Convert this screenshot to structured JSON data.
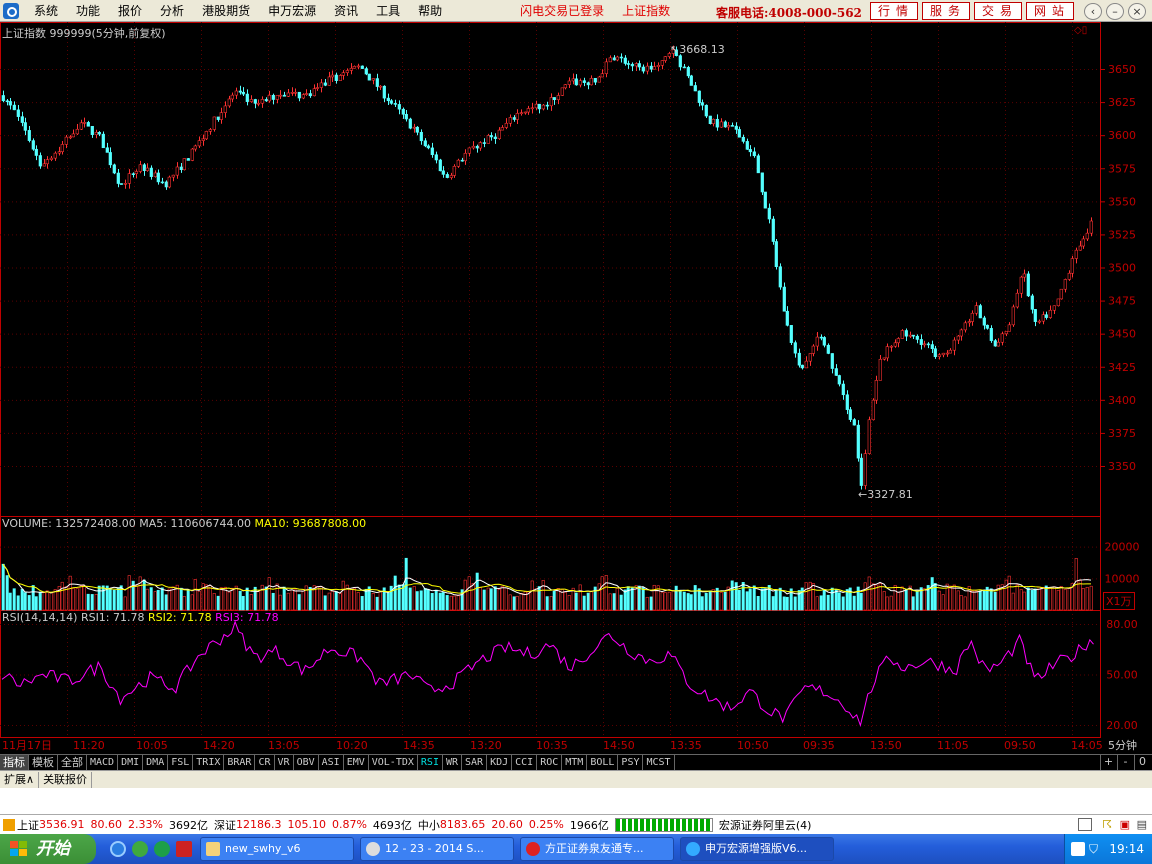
{
  "menubar": {
    "items": [
      "系统",
      "功能",
      "报价",
      "分析",
      "港股期货",
      "申万宏源",
      "资讯",
      "工具",
      "帮助"
    ],
    "status": "闪电交易已登录",
    "index_link": "上证指数",
    "hotline": "客服电话:4008-000-562",
    "buttons": [
      "行情",
      "服务",
      "交易",
      "网站"
    ]
  },
  "main_chart": {
    "header": "上证指数 999999(5分钟,前复权)",
    "y_ticks": [
      "3650",
      "3625",
      "3600",
      "3575",
      "3550",
      "3525",
      "3500",
      "3475",
      "3450",
      "3425",
      "3400",
      "3375",
      "3350"
    ],
    "high_label": "3668.13",
    "low_label": "3327.81"
  },
  "volume": {
    "header_volume": "VOLUME: 132572408.00",
    "header_ma5": "MA5: 110606744.00",
    "header_ma10": "MA10: 93687808.00",
    "y_ticks": [
      "20000",
      "10000"
    ],
    "unit": "X1万"
  },
  "rsi": {
    "header_name": "RSI(14,14,14)",
    "rsi1": "RSI1: 71.78",
    "rsi2": "RSI2: 71.78",
    "rsi3": "RSI3: 71.78",
    "y_ticks": [
      "80.00",
      "50.00",
      "20.00"
    ]
  },
  "time_axis": {
    "labels": [
      "11月17日",
      "11:20",
      "10:05",
      "14:20",
      "13:05",
      "10:20",
      "14:35",
      "13:20",
      "10:35",
      "14:50",
      "13:35",
      "10:50",
      "09:35",
      "13:50",
      "11:05",
      "09:50",
      "14:05"
    ],
    "period": "5分钟"
  },
  "tabs": {
    "items": [
      "指标",
      "模板",
      "全部",
      "MACD",
      "DMI",
      "DMA",
      "FSL",
      "TRIX",
      "BRAR",
      "CR",
      "VR",
      "OBV",
      "ASI",
      "EMV",
      "VOL-TDX",
      "RSI",
      "WR",
      "SAR",
      "KDJ",
      "CCI",
      "ROC",
      "MTM",
      "BOLL",
      "PSY",
      "MCST"
    ],
    "controls": [
      "+",
      "-",
      "0"
    ]
  },
  "extbar": {
    "items": [
      "扩展∧",
      "关联报价"
    ]
  },
  "quotebar": {
    "sh_label": "上证",
    "sh_value": "3536.91",
    "sh_change": "80.60",
    "sh_pct": "2.33%",
    "sh_amount": "3692亿",
    "sz_label": "深证",
    "sz_value": "12186.3",
    "sz_change": "105.10",
    "sz_pct": "0.87%",
    "sz_amount": "4693亿",
    "zx_label": "中小",
    "zx_value": "8183.65",
    "zx_change": "20.60",
    "zx_pct": "0.25%",
    "zx_amount": "1966亿",
    "server": "宏源证券阿里云(4)"
  },
  "taskbar": {
    "start": "开始",
    "windows": [
      "new_swhy_v6",
      "12 - 23 - 2014 S...",
      "方正证券泉友通专...",
      "申万宏源增强版V6..."
    ],
    "clock": "19:14"
  },
  "colors": {
    "up": "#ff3232",
    "down": "#54ffff",
    "axis": "#c00000",
    "rsi": "#ff00ff"
  }
}
